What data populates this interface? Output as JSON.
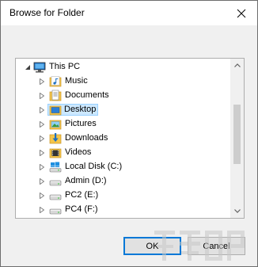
{
  "window": {
    "title": "Browse for Folder",
    "close_icon": "close-icon"
  },
  "tree": {
    "root": {
      "label": "This PC",
      "icon": "computer-icon",
      "expanded": true
    },
    "items": [
      {
        "label": "Music",
        "icon": "music-folder-icon",
        "selected": false
      },
      {
        "label": "Documents",
        "icon": "documents-folder-icon",
        "selected": false
      },
      {
        "label": "Desktop",
        "icon": "desktop-folder-icon",
        "selected": true
      },
      {
        "label": "Pictures",
        "icon": "pictures-folder-icon",
        "selected": false
      },
      {
        "label": "Downloads",
        "icon": "downloads-folder-icon",
        "selected": false
      },
      {
        "label": "Videos",
        "icon": "videos-folder-icon",
        "selected": false
      },
      {
        "label": "Local Disk (C:)",
        "icon": "windows-drive-icon",
        "selected": false
      },
      {
        "label": "Admin (D:)",
        "icon": "drive-icon",
        "selected": false
      },
      {
        "label": "PC2 (E:)",
        "icon": "drive-icon",
        "selected": false
      },
      {
        "label": "PC4 (F:)",
        "icon": "drive-icon",
        "selected": false
      }
    ]
  },
  "buttons": {
    "ok": "OK",
    "cancel": "Cancel"
  },
  "colors": {
    "selection_bg": "#cce8ff",
    "selection_border": "#99d1ff",
    "accent": "#0078d7",
    "dialog_bg": "#f0f0f0"
  }
}
